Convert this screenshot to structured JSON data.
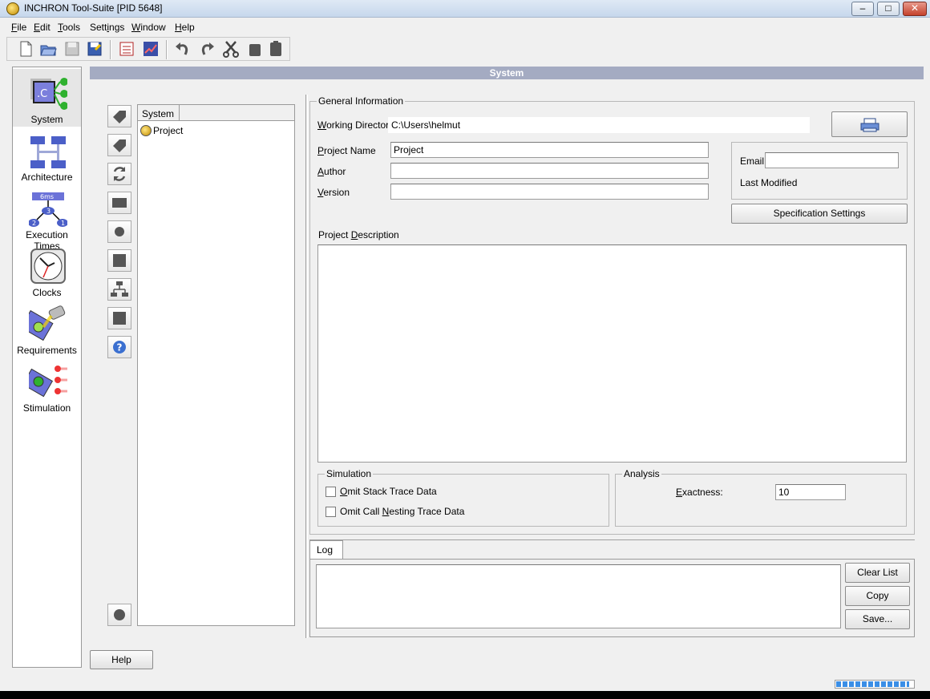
{
  "window": {
    "title": "INCHRON Tool-Suite [PID 5648]",
    "minimize_glyph": "–",
    "maximize_glyph": "□",
    "close_glyph": "✕"
  },
  "menu": [
    {
      "label": "File",
      "ul": "F",
      "rest": "ile"
    },
    {
      "label": "Edit",
      "ul": "E",
      "rest": "dit"
    },
    {
      "label": "Tools",
      "ul": "T",
      "rest": "ools"
    },
    {
      "label": "Settings",
      "pre": "Sett",
      "ul": "i",
      "rest": "ngs"
    },
    {
      "label": "Window",
      "ul": "W",
      "rest": "indow"
    },
    {
      "label": "Help",
      "ul": "H",
      "rest": "elp"
    }
  ],
  "nav": [
    {
      "label": "System",
      "icon": "system-icon"
    },
    {
      "label": "Architecture",
      "icon": "architecture-icon"
    },
    {
      "label": "Execution Times",
      "icon": "execution-times-icon"
    },
    {
      "label": "Clocks",
      "icon": "clocks-icon"
    },
    {
      "label": "Requirements",
      "icon": "requirements-icon"
    },
    {
      "label": "Stimulation",
      "icon": "stimulation-icon"
    }
  ],
  "nav_badges": {
    "exec_top": "6ms",
    "exec_mid": "3",
    "exec_left": "2",
    "exec_right": "1",
    "system_glyph": ".C"
  },
  "section_header": "System",
  "tree": {
    "column": "System",
    "items": [
      "Project"
    ]
  },
  "general": {
    "legend": "General Information",
    "working_dir_label_ul": "W",
    "working_dir_label_rest": "orking Directory",
    "working_dir_value": "C:\\Users\\helmut",
    "project_name_label_ul": "P",
    "project_name_label_rest": "roject Name",
    "project_name_value": "Project",
    "author_label_ul": "A",
    "author_label_rest": "uthor",
    "author_value": "",
    "version_label_ul": "V",
    "version_label_rest": "ersion",
    "version_value": "",
    "email_label": "Email",
    "email_value": "",
    "last_modified_label": "Last Modified",
    "spec_settings_button": "Specification Settings",
    "description_label_pre": "Project ",
    "description_label_ul": "D",
    "description_label_rest": "escription",
    "description_value": ""
  },
  "simulation": {
    "legend": "Simulation",
    "omit_stack_pre": "",
    "omit_stack_ul": "O",
    "omit_stack_rest": "mit Stack Trace Data",
    "omit_call_pre": "Omit Call ",
    "omit_call_ul": "N",
    "omit_call_rest": "esting Trace Data"
  },
  "analysis": {
    "legend": "Analysis",
    "exactness_ul": "E",
    "exactness_rest": "xactness:",
    "exactness_value": "10"
  },
  "log": {
    "tab": "Log",
    "clear_button": "Clear List",
    "copy_button": "Copy",
    "save_button": "Save..."
  },
  "help_button": "Help",
  "progress_fraction": 0.95
}
